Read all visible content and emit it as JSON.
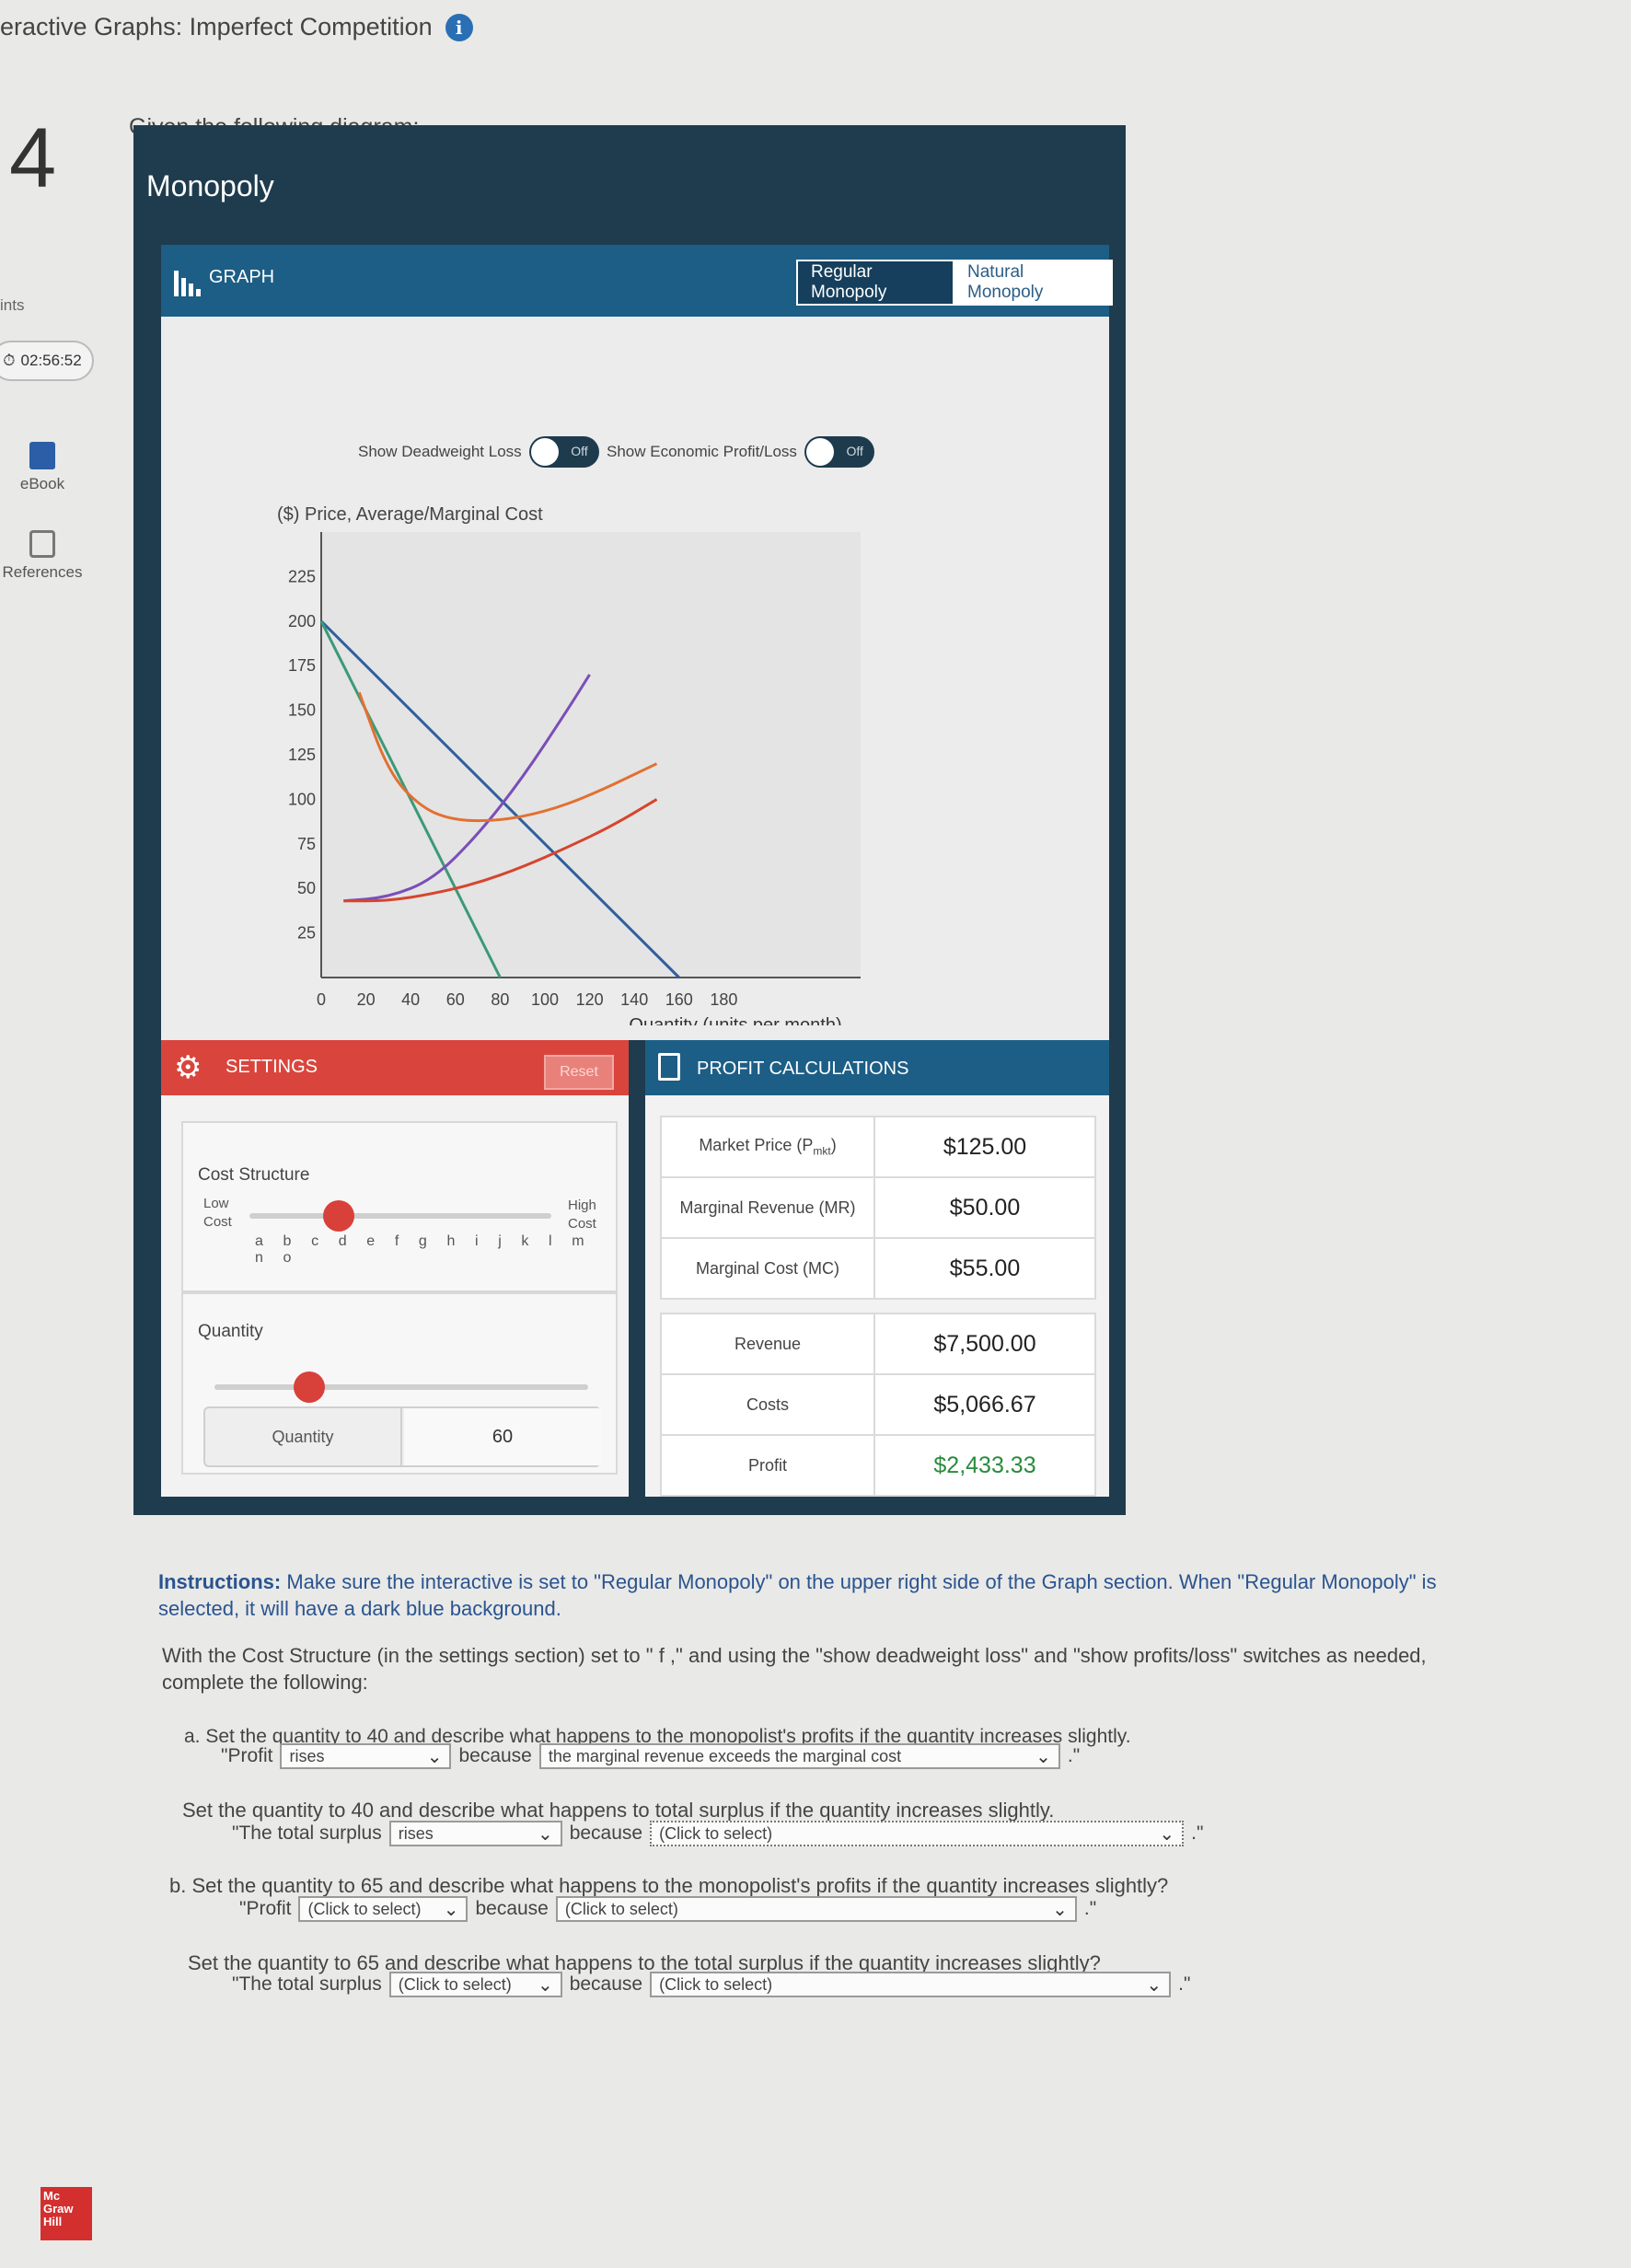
{
  "page_title": "eractive Graphs: Imperfect Competition",
  "question_number": "4",
  "points_label": "ints",
  "timer": "02:56:52",
  "sidebar": {
    "ebook": "eBook",
    "references": "References"
  },
  "logo": "Mc Graw Hill",
  "given_text": "Given the following diagram:",
  "widget": {
    "title": "Monopoly",
    "graph_label": "GRAPH",
    "modes": [
      "Regular Monopoly",
      "Natural Monopoly"
    ],
    "selected_mode": "Regular Monopoly",
    "toggles": [
      {
        "label": "Show Deadweight Loss",
        "state": "Off"
      },
      {
        "label": "Show Economic Profit/Loss",
        "state": "Off"
      }
    ]
  },
  "chart_data": {
    "type": "line",
    "ylabel": "($) Price, Average/Marginal Cost",
    "xlabel": "Quantity (units per month)",
    "xlim": [
      0,
      200
    ],
    "ylim": [
      0,
      250
    ],
    "x_ticks": [
      0,
      20,
      40,
      60,
      80,
      100,
      120,
      140,
      160,
      180
    ],
    "y_ticks": [
      25,
      50,
      75,
      100,
      125,
      150,
      175,
      200,
      225
    ],
    "series": [
      {
        "color": "#2f5f9e",
        "x": [
          0,
          160
        ],
        "y": [
          200,
          0
        ]
      },
      {
        "color": "#3a9a78",
        "x": [
          0,
          80
        ],
        "y": [
          200,
          0
        ]
      },
      {
        "color": "#7a4eb8",
        "x": [
          10,
          30,
          50,
          70,
          90,
          110,
          120
        ],
        "y": [
          43,
          45,
          55,
          80,
          112,
          150,
          170
        ]
      },
      {
        "color": "#e27032",
        "x": [
          17,
          30,
          45,
          60,
          80,
          100,
          120,
          150
        ],
        "y": [
          160,
          115,
          95,
          88,
          88,
          93,
          102,
          120
        ]
      },
      {
        "color": "#d6452e",
        "x": [
          10,
          30,
          50,
          70,
          90,
          110,
          130,
          150
        ],
        "y": [
          43,
          43,
          47,
          53,
          62,
          73,
          85,
          100
        ]
      }
    ]
  },
  "settings": {
    "header": "SETTINGS",
    "reset": "Reset",
    "cost_structure_title": "Cost Structure",
    "low_cost": "Low Cost",
    "high_cost": "High Cost",
    "letters": "a b c d e f g h i j k l m n o",
    "cost_selected": "f",
    "quantity_title": "Quantity",
    "quantity_min": "40",
    "quantity_max": "120",
    "quantity_field_label": "Quantity",
    "quantity_value": "60"
  },
  "profit_calc": {
    "header": "PROFIT CALCULATIONS",
    "market_price_label": "Market Price (P",
    "market_price_sub": "mkt",
    "market_price_close": ")",
    "market_price": "$125.00",
    "mr_label": "Marginal Revenue (MR)",
    "mr": "$50.00",
    "mc_label": "Marginal Cost (MC)",
    "mc": "$55.00",
    "revenue_label": "Revenue",
    "revenue": "$7,500.00",
    "costs_label": "Costs",
    "costs": "$5,066.67",
    "profit_label": "Profit",
    "profit": "$2,433.33"
  },
  "instructions": {
    "bold": "Instructions:",
    "text": " Make sure the interactive is set to \"Regular Monopoly\" on the upper right side of the Graph section. When \"Regular Monopoly\" is selected, it will have a dark blue background.",
    "para": "With the Cost Structure (in the settings section) set to \" f ,\" and using the \"show deadweight loss\" and \"show profits/loss\" switches as needed, complete the following:"
  },
  "questions": [
    {
      "prompt": "a. Set the quantity to 40 and describe what happens to the monopolist's profits if the quantity increases slightly.",
      "prefix": "\"Profit",
      "answer1": "rises",
      "because": "because",
      "answer2": "the marginal revenue exceeds the marginal cost",
      "suffix": ".\""
    },
    {
      "prompt": "Set the quantity to 40 and describe what happens to total surplus if the quantity increases slightly.",
      "prefix": "\"The total surplus",
      "answer1": "rises",
      "because": "because",
      "answer2": "(Click to select)",
      "suffix": ".\""
    },
    {
      "prompt": "b. Set the quantity to 65 and describe what happens to the monopolist's profits if the quantity increases slightly?",
      "prefix": "\"Profit",
      "answer1": "(Click to select)",
      "because": "because",
      "answer2": "(Click to select)",
      "suffix": ".\""
    },
    {
      "prompt": "Set the quantity to 65 and describe what happens to the total surplus if the quantity increases slightly?",
      "prefix": "\"The total surplus",
      "answer1": "(Click to select)",
      "because": "because",
      "answer2": "(Click to select)",
      "suffix": ".\""
    }
  ]
}
